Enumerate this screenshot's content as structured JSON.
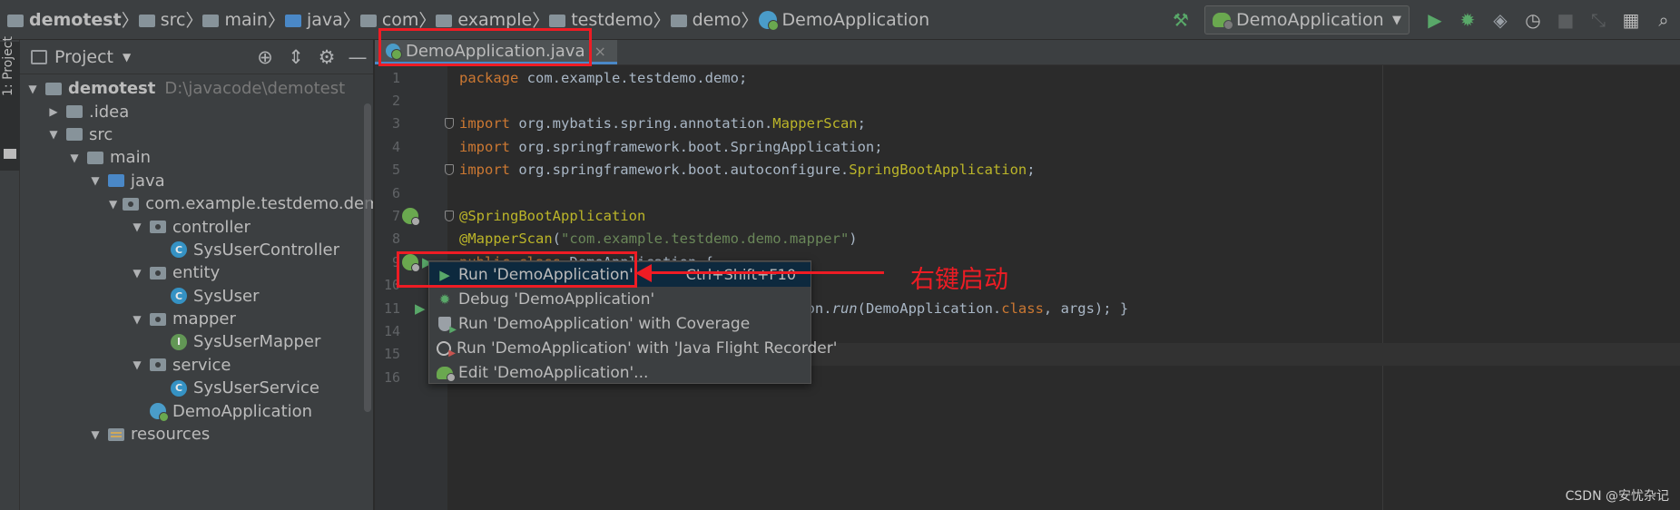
{
  "breadcrumb": {
    "items": [
      {
        "label": "demotest",
        "icon": "project-folder-icon"
      },
      {
        "label": "src",
        "icon": "folder-icon"
      },
      {
        "label": "main",
        "icon": "folder-icon"
      },
      {
        "label": "java",
        "icon": "source-folder-icon"
      },
      {
        "label": "com",
        "icon": "package-icon"
      },
      {
        "label": "example",
        "icon": "package-icon"
      },
      {
        "label": "testdemo",
        "icon": "package-icon"
      },
      {
        "label": "demo",
        "icon": "package-icon"
      },
      {
        "label": "DemoApplication",
        "icon": "spring-boot-class-icon"
      }
    ]
  },
  "toolbar": {
    "run_config": "DemoApplication",
    "icons": [
      "build-hammer-icon",
      "run-icon",
      "debug-icon",
      "coverage-icon",
      "profiler-icon",
      "stop-icon",
      "vcs-icon",
      "project-structure-icon",
      "search-icon"
    ]
  },
  "left_stripe": {
    "tab_label": "1: Project"
  },
  "project_panel": {
    "title": "Project",
    "tree": [
      {
        "label": "demotest",
        "note": "D:\\javacode\\demotest",
        "icon": "project",
        "expanded": true
      },
      {
        "label": ".idea",
        "icon": "folder",
        "expanded": false
      },
      {
        "label": "src",
        "icon": "folder",
        "expanded": true
      },
      {
        "label": "main",
        "icon": "folder",
        "expanded": true
      },
      {
        "label": "java",
        "icon": "source-folder",
        "expanded": true
      },
      {
        "label": "com.example.testdemo.demo",
        "icon": "package",
        "expanded": true
      },
      {
        "label": "controller",
        "icon": "package",
        "expanded": true
      },
      {
        "label": "SysUserController",
        "icon": "class"
      },
      {
        "label": "entity",
        "icon": "package",
        "expanded": true
      },
      {
        "label": "SysUser",
        "icon": "class"
      },
      {
        "label": "mapper",
        "icon": "package",
        "expanded": true
      },
      {
        "label": "SysUserMapper",
        "icon": "interface"
      },
      {
        "label": "service",
        "icon": "package",
        "expanded": true
      },
      {
        "label": "SysUserService",
        "icon": "class"
      },
      {
        "label": "DemoApplication",
        "icon": "spring-boot-class"
      },
      {
        "label": "resources",
        "icon": "resources-folder",
        "expanded": true
      }
    ]
  },
  "editor": {
    "tab": {
      "label": "DemoApplication.java",
      "close": "×"
    },
    "lines": [
      {
        "n": "1",
        "segs": [
          [
            "kw",
            "package "
          ],
          [
            "",
            "com.example.testdemo.demo;"
          ]
        ]
      },
      {
        "n": "2",
        "segs": []
      },
      {
        "n": "3",
        "segs": [
          [
            "kw",
            "import "
          ],
          [
            "",
            "org.mybatis.spring.annotation."
          ],
          [
            "an",
            "MapperScan"
          ],
          [
            "",
            ";"
          ]
        ]
      },
      {
        "n": "4",
        "segs": [
          [
            "kw",
            "import "
          ],
          [
            "",
            "org.springframework.boot.SpringApplication;"
          ]
        ]
      },
      {
        "n": "5",
        "segs": [
          [
            "kw",
            "import "
          ],
          [
            "",
            "org.springframework.boot.autoconfigure."
          ],
          [
            "an",
            "SpringBootApplication"
          ],
          [
            "",
            ";"
          ]
        ]
      },
      {
        "n": "6",
        "segs": []
      },
      {
        "n": "7",
        "segs": [
          [
            "an",
            "@SpringBootApplication"
          ]
        ]
      },
      {
        "n": "8",
        "segs": [
          [
            "an",
            "@MapperScan"
          ],
          [
            "",
            "("
          ],
          [
            "str",
            "\"com.example.testdemo.demo.mapper\""
          ],
          [
            "",
            ")"
          ]
        ]
      },
      {
        "n": "9",
        "segs": [
          [
            "kw",
            "public class "
          ],
          [
            "",
            "DemoApplication {"
          ]
        ]
      },
      {
        "n": "10",
        "segs": []
      },
      {
        "n": "11",
        "segs": [
          [
            "",
            "                           pringApplication."
          ],
          [
            "it",
            "run"
          ],
          [
            "",
            "(DemoApplication."
          ],
          [
            "kw",
            "class"
          ],
          [
            "",
            ", args); }"
          ]
        ]
      },
      {
        "n": "14",
        "segs": []
      },
      {
        "n": "15",
        "segs": []
      },
      {
        "n": "16",
        "segs": []
      }
    ]
  },
  "context_menu": {
    "items": [
      {
        "label": "Run 'DemoApplication'",
        "shortcut": "Ctrl+Shift+F10",
        "icon": "run-icon"
      },
      {
        "label": "Debug 'DemoApplication'",
        "shortcut": "",
        "icon": "debug-icon"
      },
      {
        "label": "Run 'DemoApplication' with Coverage",
        "shortcut": "",
        "icon": "coverage-icon"
      },
      {
        "label": "Run 'DemoApplication' with 'Java Flight Recorder'",
        "shortcut": "",
        "icon": "flight-recorder-icon"
      },
      {
        "label": "Edit 'DemoApplication'...",
        "shortcut": "",
        "icon": "edit-config-icon"
      }
    ]
  },
  "annotation": {
    "text": "右键启动",
    "color": "#ee1c24"
  },
  "watermark": "CSDN @安忧杂记",
  "colors": {
    "keyword": "#cc7832",
    "annotation": "#bbb529",
    "string": "#6a8759",
    "selection": "#0d293e"
  }
}
